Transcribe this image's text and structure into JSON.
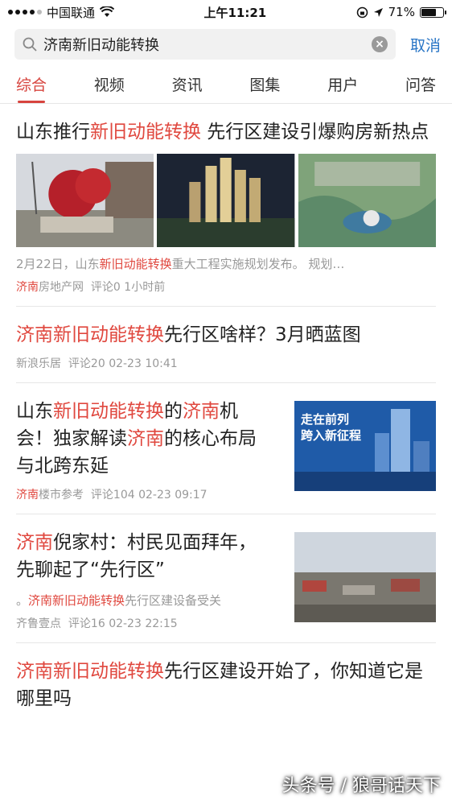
{
  "status": {
    "carrier": "中国联通",
    "time": "上午11:21",
    "battery": "71%",
    "battery_level": 0.71
  },
  "search": {
    "query": "济南新旧动能转换",
    "cancel": "取消"
  },
  "tabs": [
    "综合",
    "视频",
    "资讯",
    "图集",
    "用户",
    "问答"
  ],
  "items": [
    {
      "title_a": "山东推行",
      "title_hl": "新旧动能转换",
      "title_b": " 先行区建设引爆购房新热点",
      "snippet_a": "2月22日，山东",
      "snippet_hl": "新旧动能转换",
      "snippet_b": "重大工程实施规划发布。 规划…",
      "source_hl": "济南",
      "source": "房地产网",
      "comments": "评论0",
      "time": "1小时前"
    },
    {
      "title_hl": "济南新旧动能转换",
      "title_b": "先行区啥样？3月晒蓝图",
      "source": "新浪乐居",
      "comments": "评论20",
      "time": "02-23 10:41"
    },
    {
      "title_a": "山东",
      "title_hl": "新旧动能转换",
      "title_b": "的",
      "title_hl2": "济南",
      "title_c": "机会！独家解读",
      "title_hl3": "济南",
      "title_d": "的核心布局与北跨东延",
      "source_hl": "济南",
      "source": "楼市参考",
      "comments": "评论104",
      "time": "02-23 09:17",
      "thumb_line1": "走在前列",
      "thumb_line2": "跨入新征程"
    },
    {
      "title_hl": "济南",
      "title_b": "倪家村：村民见面拜年，先聊起了“先行区”",
      "snippet_a": "。",
      "snippet_hl": "济南新旧动能转换",
      "snippet_b": "先行区建设备受关",
      "source": "齐鲁壹点",
      "comments": "评论16",
      "time": "02-23 22:15"
    },
    {
      "title_hl": "济南新旧动能转换",
      "title_b": "先行区建设开始了，你知道它是哪里吗"
    }
  ],
  "watermark": "头条号 / 狼哥话天下",
  "colors": {
    "accent": "#e0483f",
    "link": "#2a76c6"
  }
}
